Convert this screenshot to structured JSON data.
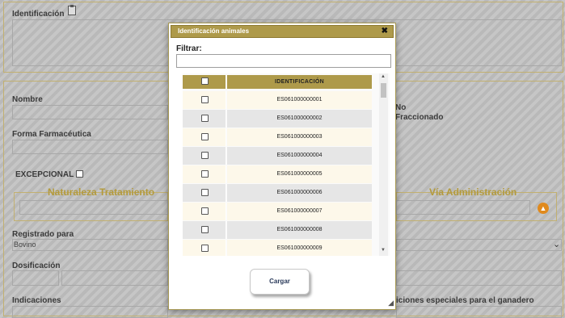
{
  "background": {
    "identificacion_label": "Identificación",
    "nombre_label": "Nombre",
    "no_fraccionado_label_1": "No",
    "no_fraccionado_label_2": "Fraccionado",
    "forma_label": "Forma Farmacéutica",
    "excepcional_label": "EXCEPCIONAL",
    "naturaleza_legend": "Naturaleza Tratamiento",
    "via_legend": "Vía Administración",
    "registrado_label": "Registrado para",
    "registrado_value": "Bovino",
    "dosificacion_label": "Dosificación",
    "indicaciones_label": "Indicaciones",
    "condiciones_label": "iciones especiales para el ganadero"
  },
  "dialog": {
    "title": "Identificación animales",
    "close_glyph": "✖",
    "filter_label": "Filtrar:",
    "filter_value": "",
    "column_header": "IDENTIFICACIÓN",
    "rows": [
      "ES061000000001",
      "ES061000000002",
      "ES061000000003",
      "ES061000000004",
      "ES061000000005",
      "ES061000000006",
      "ES061000000007",
      "ES061000000008",
      "ES061000000009"
    ],
    "load_button": "Cargar"
  },
  "colors": {
    "accent": "#ae9a4a",
    "row_light": "#fdf8ea",
    "row_gray": "#e6e6e6",
    "orange": "#e08a1e"
  },
  "icons": [
    "clipboard-icon",
    "close-icon",
    "chevron-down-icon",
    "arrow-up-circle-icon",
    "resize-grip-icon",
    "scroll-up-icon",
    "scroll-down-icon"
  ]
}
